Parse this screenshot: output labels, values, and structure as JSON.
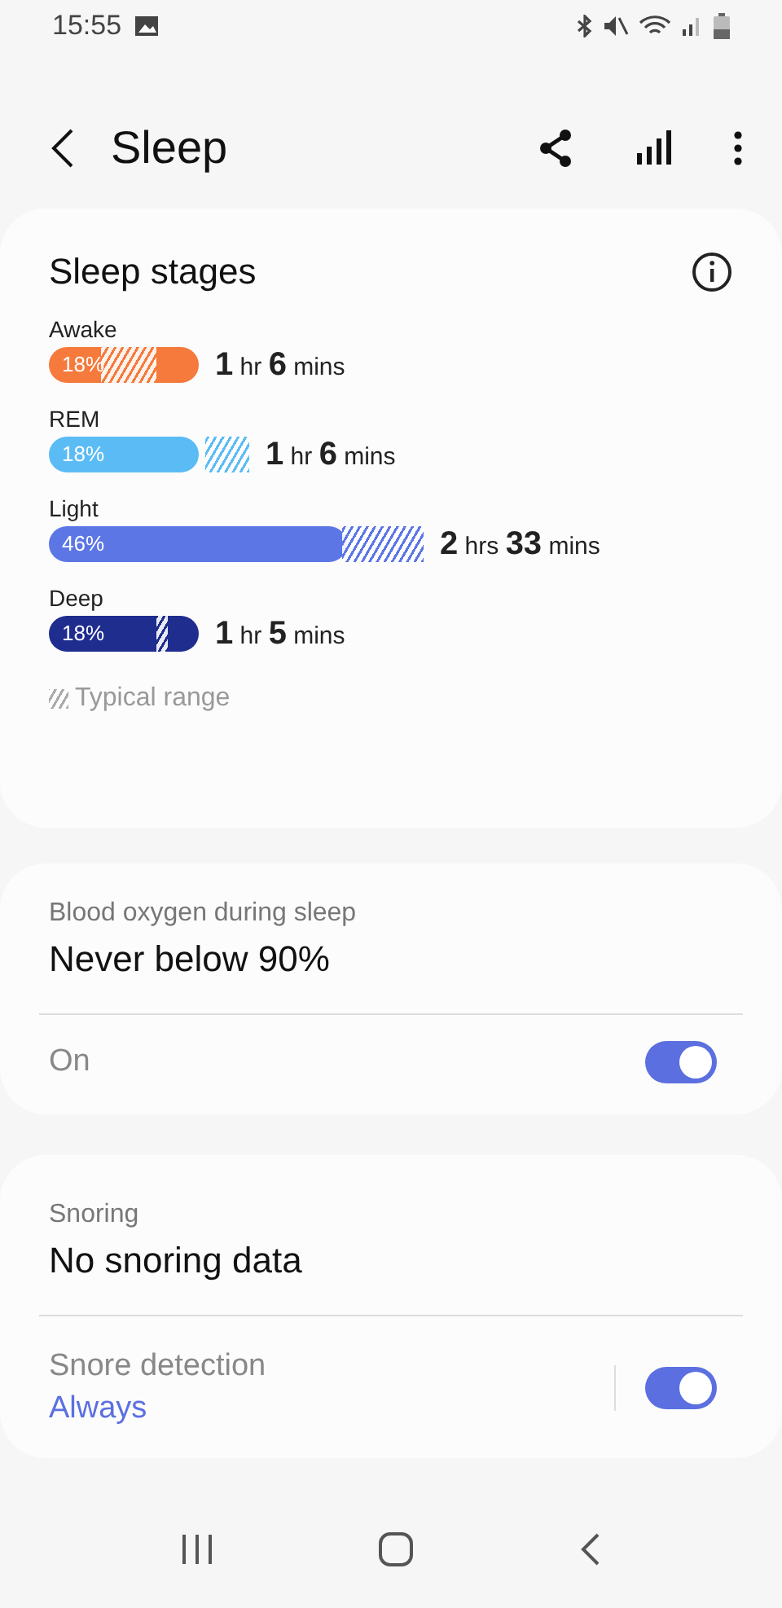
{
  "status_bar": {
    "time": "15:55"
  },
  "header": {
    "title": "Sleep"
  },
  "sleep_stages": {
    "title": "Sleep stages",
    "stages": [
      {
        "name": "Awake",
        "percent": "18%",
        "color": "#f57a3c",
        "duration": "**1** hr **6** mins"
      },
      {
        "name": "REM",
        "percent": "18%",
        "color": "#5bbcf5",
        "duration": "**1** hr **6** mins"
      },
      {
        "name": "Light",
        "percent": "46%",
        "color": "#5c76e6",
        "duration": "**2** hrs **33** mins"
      },
      {
        "name": "Deep",
        "percent": "18%",
        "color": "#1f2d8f",
        "duration": "**1** hr **5** mins"
      }
    ],
    "legend": "Typical range"
  },
  "blood_oxygen": {
    "label": "Blood oxygen during sleep",
    "value": "Never below 90%",
    "switch_label": "On",
    "on": true
  },
  "snoring": {
    "label": "Snoring",
    "value": "No snoring data",
    "switch_label": "Snore detection",
    "switch_value": "Always",
    "on": true
  }
}
